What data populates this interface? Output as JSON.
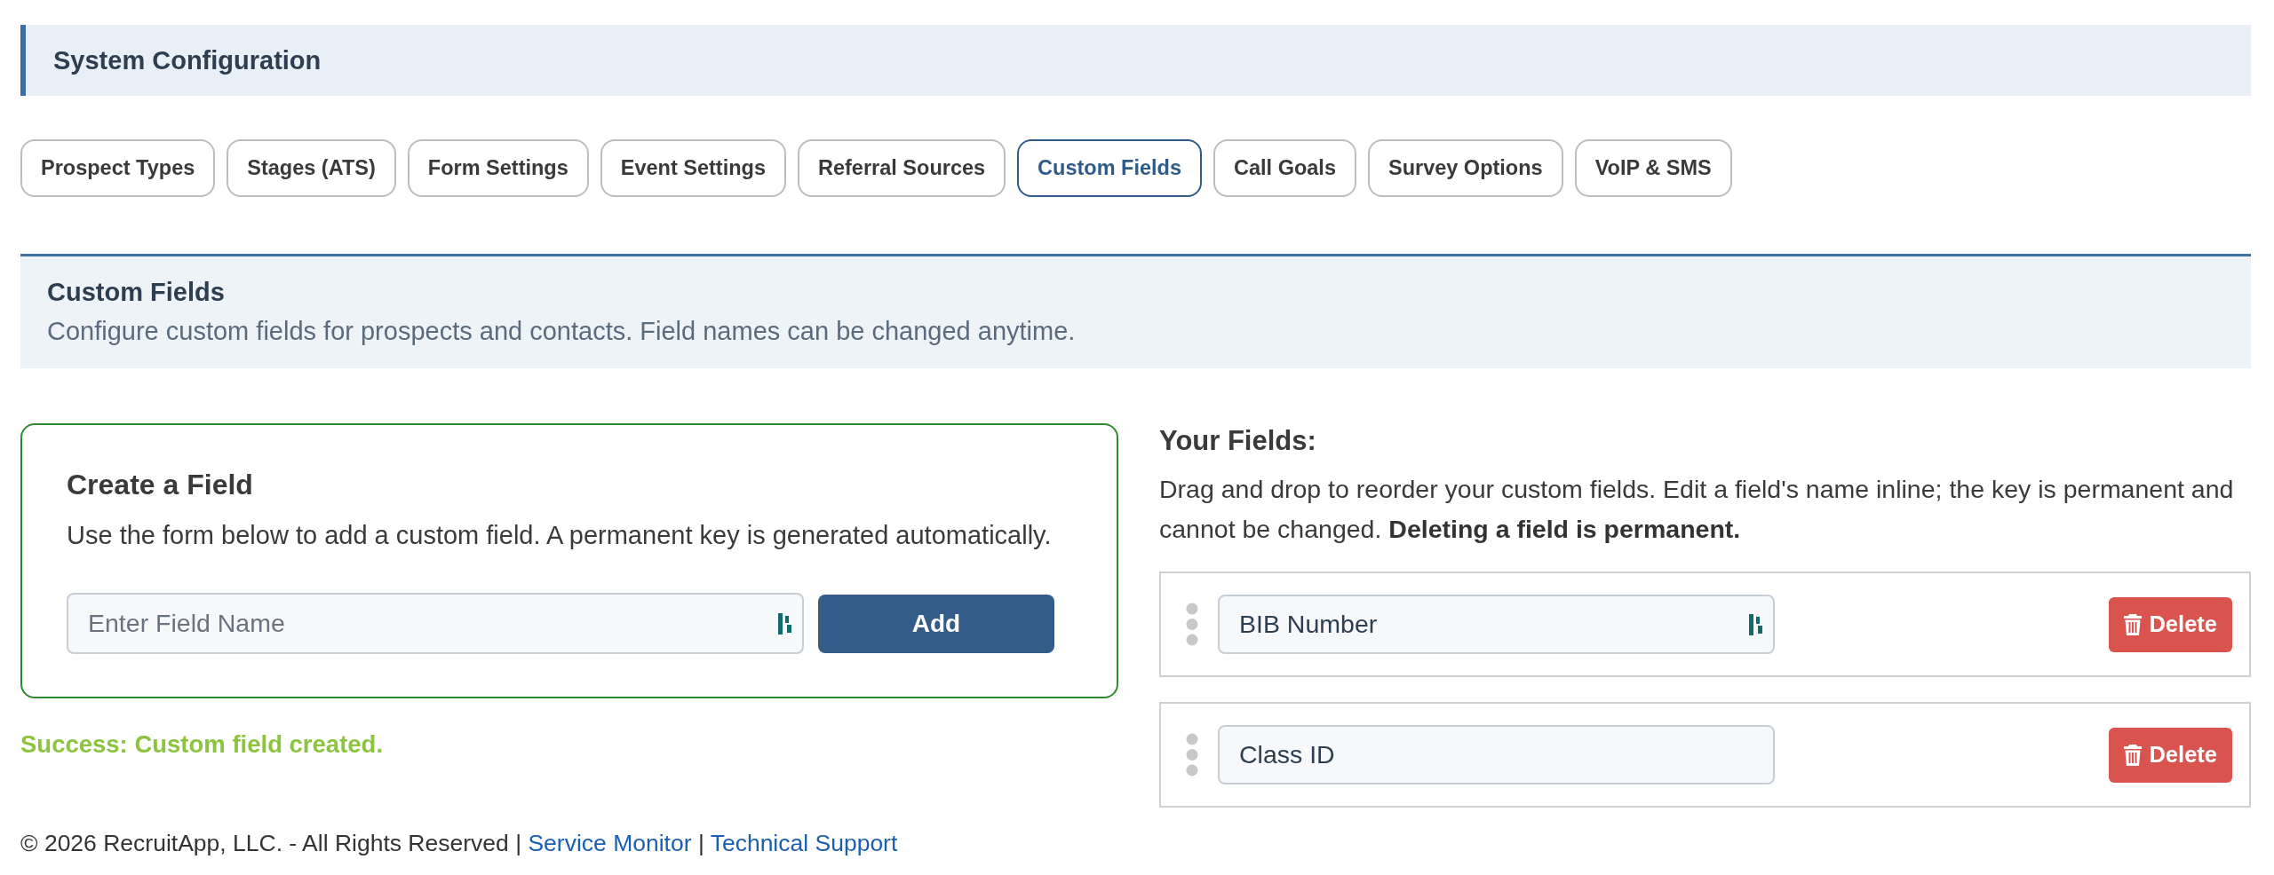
{
  "header": {
    "title": "System Configuration"
  },
  "tabs": [
    {
      "label": "Prospect Types",
      "selected": false
    },
    {
      "label": "Stages (ATS)",
      "selected": false
    },
    {
      "label": "Form Settings",
      "selected": false
    },
    {
      "label": "Event Settings",
      "selected": false
    },
    {
      "label": "Referral Sources",
      "selected": false
    },
    {
      "label": "Custom Fields",
      "selected": true
    },
    {
      "label": "Call Goals",
      "selected": false
    },
    {
      "label": "Survey Options",
      "selected": false
    },
    {
      "label": "VoIP & SMS",
      "selected": false
    }
  ],
  "section": {
    "title": "Custom Fields",
    "description": "Configure custom fields for prospects and contacts. Field names can be changed anytime."
  },
  "create_form": {
    "title": "Create a Field",
    "description": "Use the form below to add a custom field. A permanent key is generated automatically.",
    "input": {
      "placeholder": "Enter Field Name",
      "autofill_icon": true
    },
    "button": "Add"
  },
  "status_message": {
    "kind": "success",
    "text": "Success: Custom field created."
  },
  "fields_panel": {
    "title": "Your Fields:",
    "description": "Drag and drop to reorder your custom fields. Edit a field's name inline; the key is permanent and cannot be changed. **Deleting a field is permanent.**",
    "fields": [
      {
        "value": "BIB Number",
        "autofill_icon": true,
        "delete_button": "Delete"
      },
      {
        "value": "Class ID",
        "autofill_icon": false,
        "delete_button": "Delete"
      }
    ]
  },
  "footer": {
    "items": [
      {
        "kind": "text",
        "text": "© 2026 RecruitApp, LLC. - All Rights Reserved |"
      },
      {
        "kind": "link",
        "text": "Service Monitor"
      },
      {
        "kind": "separator",
        "text": "|"
      },
      {
        "kind": "link",
        "text": "Technical Support"
      }
    ]
  }
}
